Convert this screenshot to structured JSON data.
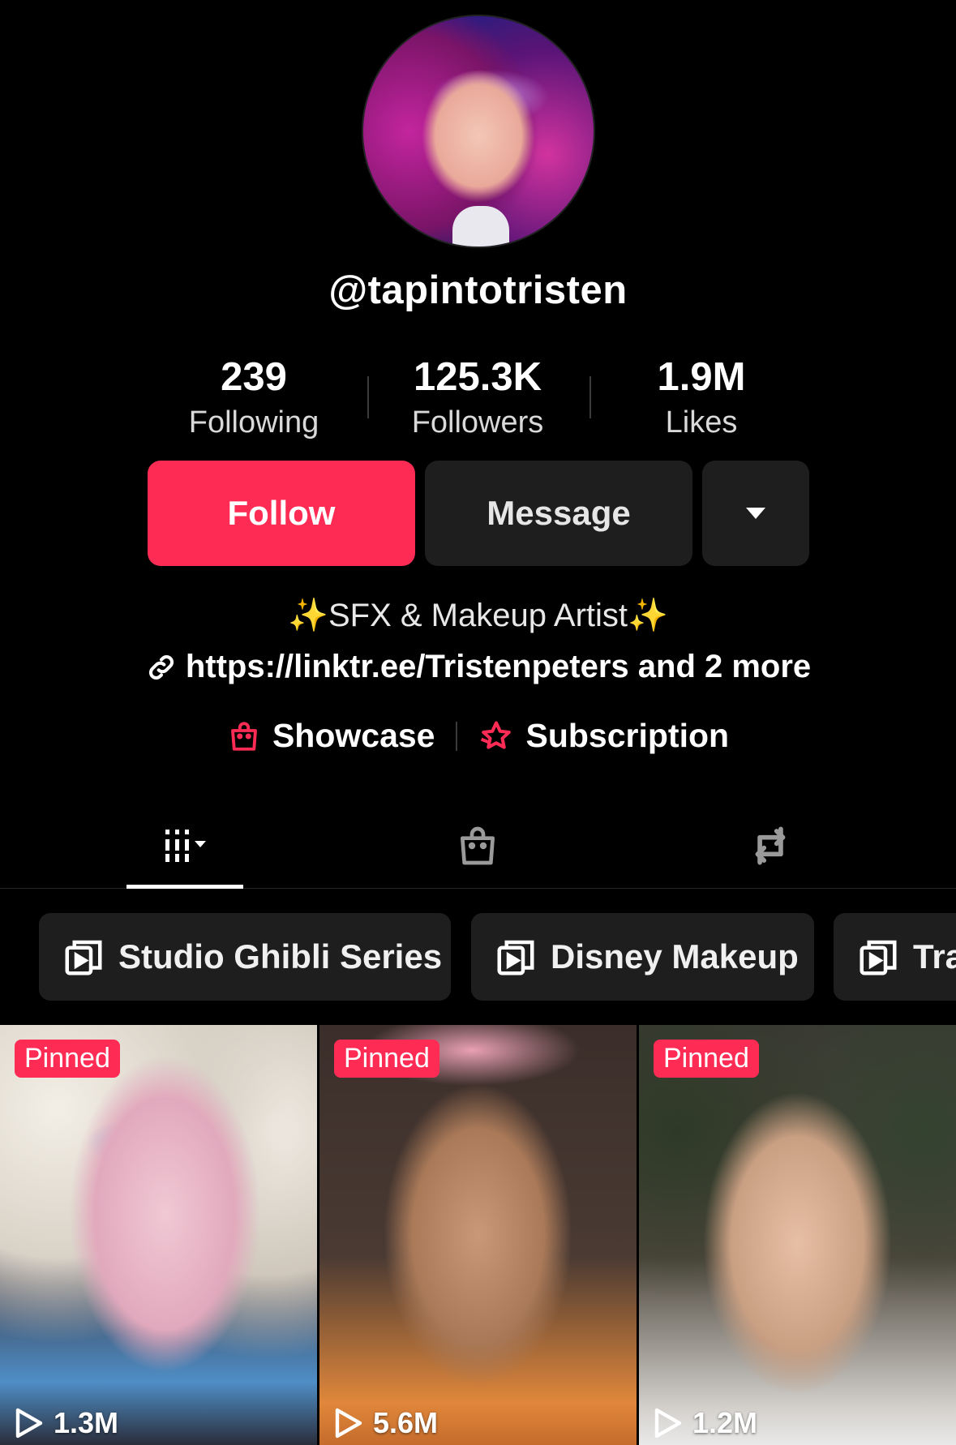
{
  "profile": {
    "username": "@tapintotristen"
  },
  "stats": {
    "following_count": "239",
    "following_label": "Following",
    "followers_count": "125.3K",
    "followers_label": "Followers",
    "likes_count": "1.9M",
    "likes_label": "Likes"
  },
  "actions": {
    "follow_label": "Follow",
    "message_label": "Message",
    "more_icon": "caret-down-icon"
  },
  "bio": {
    "sparkle_left": "✨",
    "text": "SFX & Makeup Artist",
    "sparkle_right": "✨",
    "link_text": "https://linktr.ee/Tristenpeters and 2 more"
  },
  "shop": {
    "showcase_label": "Showcase",
    "subscription_label": "Subscription"
  },
  "tabs": [
    "videos-grid-icon",
    "shop-bag-icon",
    "repost-icon"
  ],
  "playlists": [
    {
      "label": "Studio Ghibli Series"
    },
    {
      "label": "Disney Makeup"
    },
    {
      "label": "Tra"
    }
  ],
  "videos": [
    {
      "badge": "Pinned",
      "views": "1.3M"
    },
    {
      "badge": "Pinned",
      "views": "5.6M"
    },
    {
      "badge": "Pinned",
      "views": "1.2M"
    }
  ],
  "colors": {
    "accent": "#fe2c55",
    "background": "#000000",
    "surface": "#1e1e1e",
    "sparkle": "#f8d64e"
  }
}
